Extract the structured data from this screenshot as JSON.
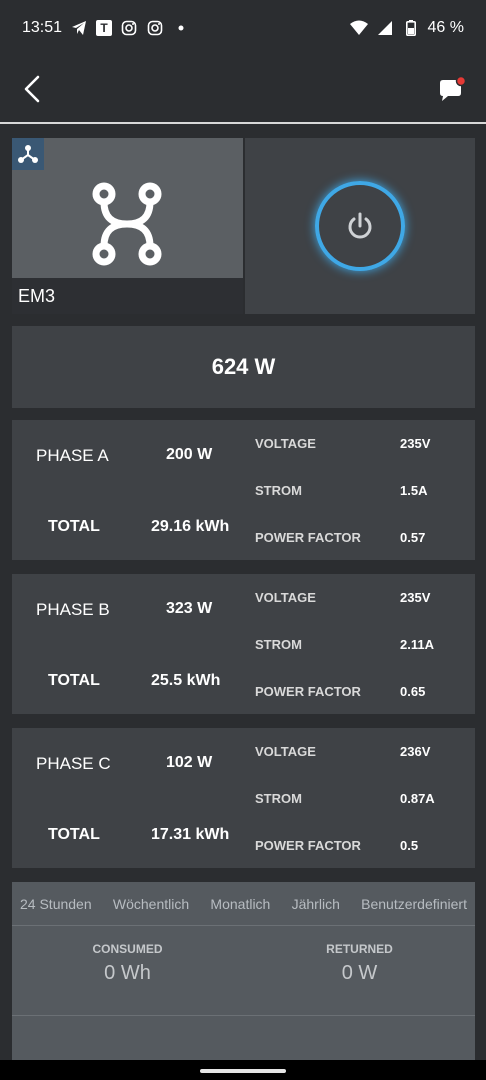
{
  "status_bar": {
    "time": "13:51",
    "battery": "46 %",
    "app_badge_letter": "T"
  },
  "device": {
    "name": "EM3"
  },
  "total_power": "624 W",
  "phases": [
    {
      "title": "PHASE A",
      "power": "200 W",
      "total_label": "TOTAL",
      "total": "29.16 kWh",
      "voltage_label": "VOLTAGE",
      "voltage": "235V",
      "current_label": "STROM",
      "current": "1.5A",
      "pf_label": "POWER FACTOR",
      "pf": "0.57"
    },
    {
      "title": "PHASE B",
      "power": "323 W",
      "total_label": "TOTAL",
      "total": "25.5 kWh",
      "voltage_label": "VOLTAGE",
      "voltage": "235V",
      "current_label": "STROM",
      "current": "2.11A",
      "pf_label": "POWER FACTOR",
      "pf": "0.65"
    },
    {
      "title": "PHASE C",
      "power": "102 W",
      "total_label": "TOTAL",
      "total": "17.31 kWh",
      "voltage_label": "VOLTAGE",
      "voltage": "236V",
      "current_label": "STROM",
      "current": "0.87A",
      "pf_label": "POWER FACTOR",
      "pf": "0.5"
    }
  ],
  "tabs": [
    "24 Stunden",
    "Wöchentlich",
    "Monatlich",
    "Jährlich",
    "Benutzerdefiniert"
  ],
  "stats": {
    "consumed_label": "CONSUMED",
    "consumed": "0 Wh",
    "returned_label": "RETURNED",
    "returned": "0 W"
  },
  "colors": {
    "accent": "#3fa8e6",
    "notification": "#e53935"
  }
}
